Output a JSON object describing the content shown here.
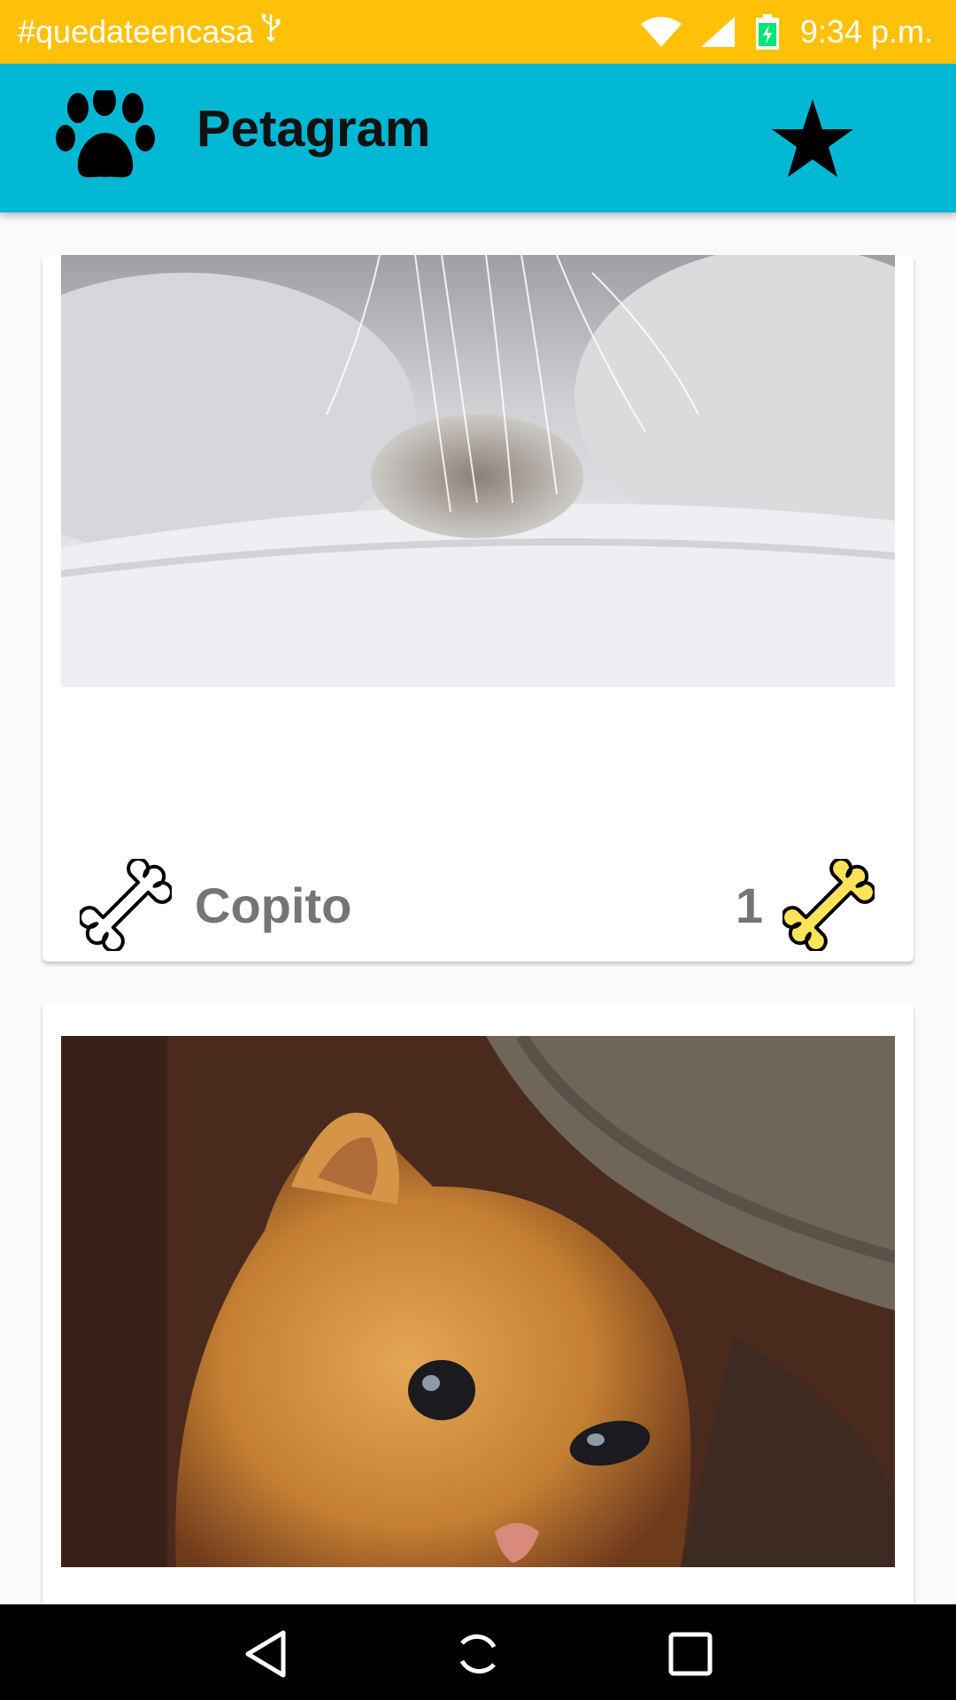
{
  "status_bar": {
    "notification_text": "#quedateencasa",
    "usb_icon": "usb-icon",
    "wifi_icon": "wifi-icon",
    "signal_icon": "cell-signal-icon",
    "battery_icon": "battery-charging-icon",
    "time": "9:34 p.m.",
    "background": "#ffc107"
  },
  "app_bar": {
    "title": "Petagram",
    "logo_icon": "paw-icon",
    "action_icon": "star-icon",
    "background": "#00b8d4"
  },
  "feed": {
    "cards": [
      {
        "image": "white-cat-photo",
        "name": "Copito",
        "likes": "1",
        "like_icon": "bone-outline-icon",
        "likes_icon": "bone-yellow-icon"
      },
      {
        "image": "orange-kitten-photo"
      }
    ]
  },
  "nav_bar": {
    "back_icon": "back-icon",
    "home_icon": "home-icon",
    "recents_icon": "recents-icon"
  }
}
